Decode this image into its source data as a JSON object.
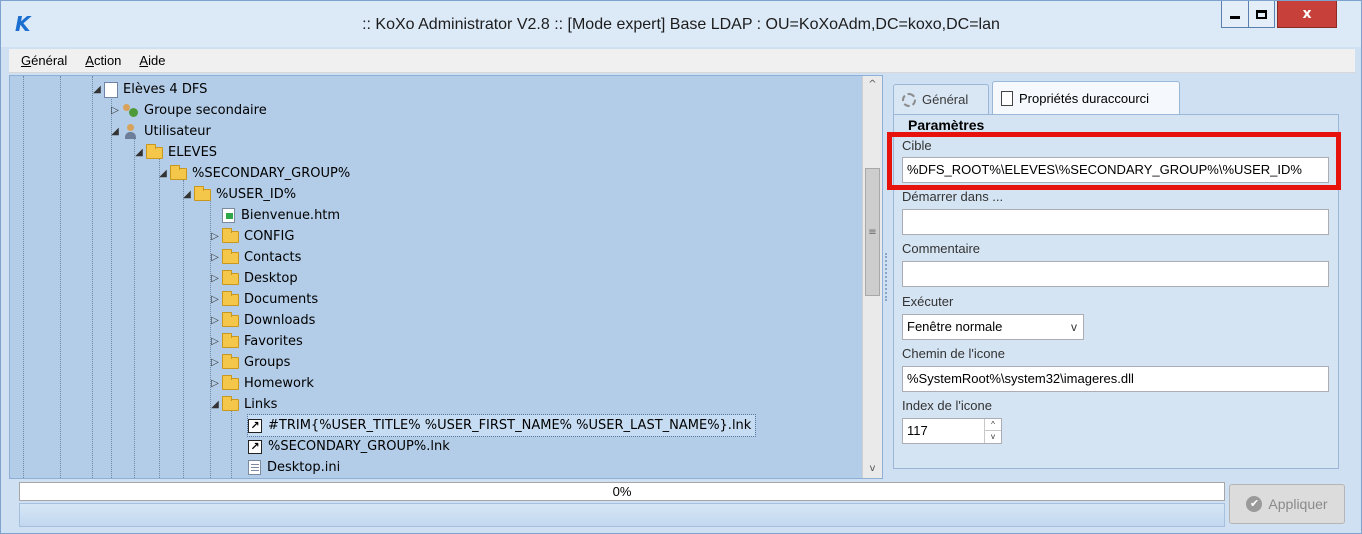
{
  "window": {
    "title": ":: KoXo Administrator V2.8 :: [Mode expert] Base LDAP : OU=KoXoAdm,DC=koxo,DC=lan",
    "logo_text": "K",
    "close_glyph": "x",
    "icons": [
      "koxo-logo-icon",
      "minimize-icon",
      "maximize-icon",
      "close-icon"
    ]
  },
  "menu": {
    "items": [
      {
        "underlined": "G",
        "rest": "énéral"
      },
      {
        "underlined": "A",
        "rest": "ction"
      },
      {
        "underlined": "A",
        "rest": "ide"
      }
    ]
  },
  "tree": {
    "rows": [
      {
        "text": "Elèves 4 DFS",
        "expander": "◢",
        "icon": "doc-icon"
      },
      {
        "text": "Groupe secondaire",
        "expander": "▷",
        "icon": "group-icon"
      },
      {
        "text": "Utilisateur",
        "expander": "◢",
        "icon": "user-icon"
      },
      {
        "text": "ELEVES",
        "expander": "◢",
        "icon": "folder-icon"
      },
      {
        "text": "%SECONDARY_GROUP%",
        "expander": "◢",
        "icon": "folder-icon"
      },
      {
        "text": "%USER_ID%",
        "expander": "◢",
        "icon": "folder-icon"
      },
      {
        "text": "Bienvenue.htm",
        "expander": "",
        "icon": "html-file-icon"
      },
      {
        "text": "CONFIG",
        "expander": "▷",
        "icon": "folder-icon"
      },
      {
        "text": "Contacts",
        "expander": "▷",
        "icon": "folder-icon"
      },
      {
        "text": "Desktop",
        "expander": "▷",
        "icon": "folder-icon"
      },
      {
        "text": "Documents",
        "expander": "▷",
        "icon": "folder-icon"
      },
      {
        "text": "Downloads",
        "expander": "▷",
        "icon": "folder-icon"
      },
      {
        "text": "Favorites",
        "expander": "▷",
        "icon": "folder-icon"
      },
      {
        "text": "Groups",
        "expander": "▷",
        "icon": "folder-icon"
      },
      {
        "text": "Homework",
        "expander": "▷",
        "icon": "folder-icon"
      },
      {
        "text": "Links",
        "expander": "◢",
        "icon": "folder-icon"
      },
      {
        "text": "#TRIM{%USER_TITLE% %USER_FIRST_NAME% %USER_LAST_NAME%}.lnk",
        "expander": "",
        "icon": "shortcut-icon",
        "selected": true
      },
      {
        "text": "%SECONDARY_GROUP%.lnk",
        "expander": "",
        "icon": "shortcut-icon"
      },
      {
        "text": "Desktop.ini",
        "expander": "",
        "icon": "ini-file-icon"
      }
    ],
    "shortcut_glyph": "↗",
    "scroll": {
      "up": "^",
      "down": "v",
      "thumb_grip": "≡"
    }
  },
  "tabs": {
    "general": "Général",
    "properties": "Propriétés duraccourci"
  },
  "form": {
    "group_title": "Paramètres",
    "cible_label": "Cible",
    "cible_value": "%DFS_ROOT%\\ELEVES\\%SECONDARY_GROUP%\\%USER_ID%",
    "demarrer_label": "Démarrer dans ...",
    "demarrer_value": "",
    "commentaire_label": "Commentaire",
    "commentaire_value": "",
    "executer_label": "Exécuter",
    "executer_value": "Fenêtre normale",
    "select_arrow": "v",
    "chemin_icone_label": "Chemin de l'icone",
    "chemin_icone_value": "%SystemRoot%\\system32\\imageres.dll",
    "index_icone_label": "Index de l'icone",
    "index_icone_value": "117",
    "spin_up": "^",
    "spin_down": "v"
  },
  "progress": {
    "label": "0%",
    "value": 0
  },
  "apply_button": {
    "label": "Appliquer",
    "icon_glyph": "✔"
  },
  "colors": {
    "window_bg": "#cfe0f2",
    "tree_bg": "#b3cde8",
    "highlight_border": "#e8120c",
    "close_button": "#c7413a"
  }
}
